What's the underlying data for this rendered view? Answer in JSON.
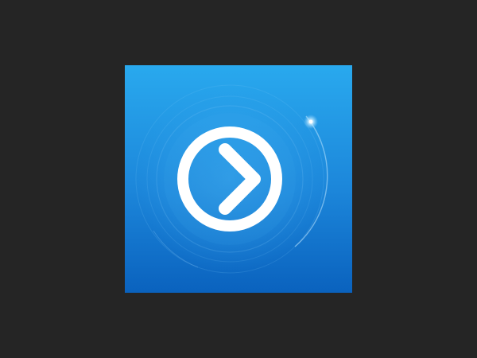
{
  "app_icon": {
    "icon": "play-forward-chevron-icon",
    "colors": {
      "background": "#252525",
      "gradient_top": "#29A9EE",
      "gradient_bottom": "#0A62BE",
      "ring": "#FFFFFF",
      "orbit": "#9ED6FF",
      "glow": "#E8F7FF"
    }
  }
}
